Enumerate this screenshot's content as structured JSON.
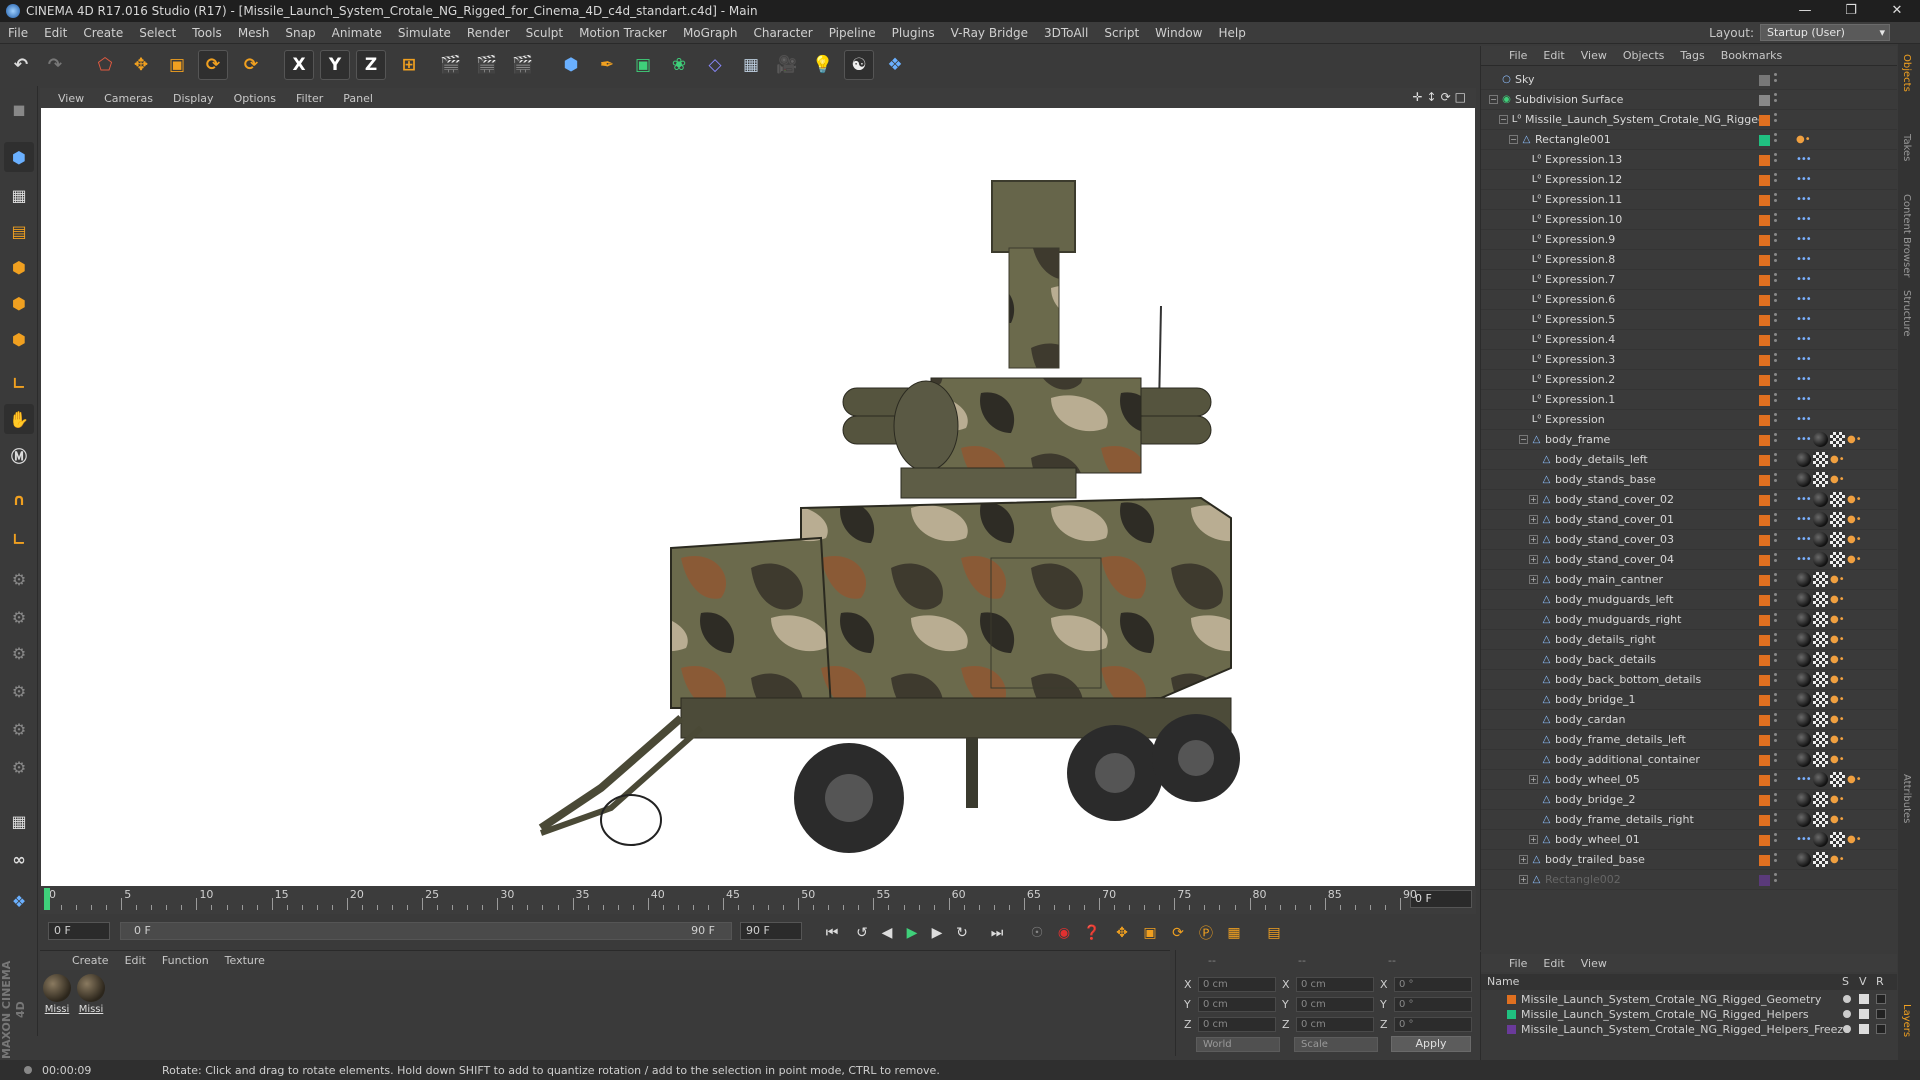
{
  "titlebar": {
    "title": "CINEMA 4D R17.016 Studio (R17) - [Missile_Launch_System_Crotale_NG_Rigged_for_Cinema_4D_c4d_standart.c4d] - Main",
    "minimize": "—",
    "maximize": "❐",
    "close": "✕"
  },
  "menubar": [
    "File",
    "Edit",
    "Create",
    "Select",
    "Tools",
    "Mesh",
    "Snap",
    "Animate",
    "Simulate",
    "Render",
    "Sculpt",
    "Motion Tracker",
    "MoGraph",
    "Character",
    "Pipeline",
    "Plugins",
    "V-Ray Bridge",
    "3DToAll",
    "Script",
    "Window",
    "Help"
  ],
  "layout": {
    "label": "Layout:",
    "value": "Startup (User)"
  },
  "toolbar_axes": {
    "x": "X",
    "y": "Y",
    "z": "Z"
  },
  "viewport_menu": [
    "View",
    "Cameras",
    "Display",
    "Options",
    "Filter",
    "Panel"
  ],
  "viewport_icons": [
    "✛",
    "↕",
    "⟳",
    "□"
  ],
  "timeline": {
    "ticks": [
      "0",
      "5",
      "10",
      "15",
      "20",
      "25",
      "30",
      "35",
      "40",
      "45",
      "50",
      "55",
      "60",
      "65",
      "70",
      "75",
      "80",
      "85",
      "90"
    ],
    "current_frame": "0 F"
  },
  "playbar": {
    "start": "0 F",
    "slider_start": "0 F",
    "slider_end": "90 F",
    "end": "90 F"
  },
  "material_menu": [
    "Create",
    "Edit",
    "Function",
    "Texture"
  ],
  "materials": [
    {
      "label": "Missi"
    },
    {
      "label": "Missi"
    }
  ],
  "coords": {
    "header_left": "--",
    "header_mid": "--",
    "header_right": "--",
    "rows": [
      {
        "a": "X",
        "av": "0 cm",
        "b": "X",
        "bv": "0 cm",
        "c": "X",
        "cv": "0 °"
      },
      {
        "a": "Y",
        "av": "0 cm",
        "b": "Y",
        "bv": "0 cm",
        "c": "Y",
        "cv": "0 °"
      },
      {
        "a": "Z",
        "av": "0 cm",
        "b": "Z",
        "bv": "0 cm",
        "c": "Z",
        "cv": "0 °"
      }
    ],
    "mode": "World",
    "scale": "Scale",
    "apply": "Apply"
  },
  "status": {
    "time": "00:00:09",
    "message": "Rotate: Click and drag to rotate elements. Hold down SHIFT to add to quantize rotation / add to the selection in point mode, CTRL to remove."
  },
  "object_menu": [
    "File",
    "Edit",
    "View",
    "Objects",
    "Tags",
    "Bookmarks"
  ],
  "objects": [
    {
      "name": "Sky",
      "level": 0,
      "expander": "",
      "icon": "sky",
      "layer": "#777777",
      "tags": []
    },
    {
      "name": "Subdivision Surface",
      "level": 0,
      "expander": "−",
      "icon": "subdiv",
      "layer": "#888888",
      "tags": []
    },
    {
      "name": "Missile_Launch_System_Crotale_NG_Rigged",
      "level": 1,
      "expander": "−",
      "icon": "null",
      "layer": "#e07020",
      "tags": []
    },
    {
      "name": "Rectangle001",
      "level": 2,
      "expander": "−",
      "icon": "poly",
      "layer": "#20c080",
      "tags": [
        "dot"
      ]
    },
    {
      "name": "Expression.13",
      "level": 3,
      "expander": "",
      "icon": "null",
      "layer": "#e07020",
      "tags": [
        "exp"
      ]
    },
    {
      "name": "Expression.12",
      "level": 3,
      "expander": "",
      "icon": "null",
      "layer": "#e07020",
      "tags": [
        "exp"
      ]
    },
    {
      "name": "Expression.11",
      "level": 3,
      "expander": "",
      "icon": "null",
      "layer": "#e07020",
      "tags": [
        "exp"
      ]
    },
    {
      "name": "Expression.10",
      "level": 3,
      "expander": "",
      "icon": "null",
      "layer": "#e07020",
      "tags": [
        "exp"
      ]
    },
    {
      "name": "Expression.9",
      "level": 3,
      "expander": "",
      "icon": "null",
      "layer": "#e07020",
      "tags": [
        "exp"
      ]
    },
    {
      "name": "Expression.8",
      "level": 3,
      "expander": "",
      "icon": "null",
      "layer": "#e07020",
      "tags": [
        "exp"
      ]
    },
    {
      "name": "Expression.7",
      "level": 3,
      "expander": "",
      "icon": "null",
      "layer": "#e07020",
      "tags": [
        "exp"
      ]
    },
    {
      "name": "Expression.6",
      "level": 3,
      "expander": "",
      "icon": "null",
      "layer": "#e07020",
      "tags": [
        "exp"
      ]
    },
    {
      "name": "Expression.5",
      "level": 3,
      "expander": "",
      "icon": "null",
      "layer": "#e07020",
      "tags": [
        "exp"
      ]
    },
    {
      "name": "Expression.4",
      "level": 3,
      "expander": "",
      "icon": "null",
      "layer": "#e07020",
      "tags": [
        "exp"
      ]
    },
    {
      "name": "Expression.3",
      "level": 3,
      "expander": "",
      "icon": "null",
      "layer": "#e07020",
      "tags": [
        "exp"
      ]
    },
    {
      "name": "Expression.2",
      "level": 3,
      "expander": "",
      "icon": "null",
      "layer": "#e07020",
      "tags": [
        "exp"
      ]
    },
    {
      "name": "Expression.1",
      "level": 3,
      "expander": "",
      "icon": "null",
      "layer": "#e07020",
      "tags": [
        "exp"
      ]
    },
    {
      "name": "Expression",
      "level": 3,
      "expander": "",
      "icon": "null",
      "layer": "#e07020",
      "tags": [
        "exp"
      ]
    },
    {
      "name": "body_frame",
      "level": 3,
      "expander": "−",
      "icon": "poly",
      "layer": "#e07020",
      "tags": [
        "exp",
        "mat",
        "chk",
        "dot"
      ]
    },
    {
      "name": "body_details_left",
      "level": 4,
      "expander": "",
      "icon": "poly",
      "layer": "#e07020",
      "tags": [
        "mat",
        "chk",
        "dot"
      ]
    },
    {
      "name": "body_stands_base",
      "level": 4,
      "expander": "",
      "icon": "poly",
      "layer": "#e07020",
      "tags": [
        "mat",
        "chk",
        "dot"
      ]
    },
    {
      "name": "body_stand_cover_02",
      "level": 4,
      "expander": "+",
      "icon": "poly",
      "layer": "#e07020",
      "tags": [
        "exp",
        "mat",
        "chk",
        "dot"
      ]
    },
    {
      "name": "body_stand_cover_01",
      "level": 4,
      "expander": "+",
      "icon": "poly",
      "layer": "#e07020",
      "tags": [
        "exp",
        "mat",
        "chk",
        "dot"
      ]
    },
    {
      "name": "body_stand_cover_03",
      "level": 4,
      "expander": "+",
      "icon": "poly",
      "layer": "#e07020",
      "tags": [
        "exp",
        "mat",
        "chk",
        "dot"
      ]
    },
    {
      "name": "body_stand_cover_04",
      "level": 4,
      "expander": "+",
      "icon": "poly",
      "layer": "#e07020",
      "tags": [
        "exp",
        "mat",
        "chk",
        "dot"
      ]
    },
    {
      "name": "body_main_cantner",
      "level": 4,
      "expander": "+",
      "icon": "poly",
      "layer": "#e07020",
      "tags": [
        "mat",
        "chk",
        "dot"
      ]
    },
    {
      "name": "body_mudguards_left",
      "level": 4,
      "expander": "",
      "icon": "poly",
      "layer": "#e07020",
      "tags": [
        "mat",
        "chk",
        "dot"
      ]
    },
    {
      "name": "body_mudguards_right",
      "level": 4,
      "expander": "",
      "icon": "poly",
      "layer": "#e07020",
      "tags": [
        "mat",
        "chk",
        "dot"
      ]
    },
    {
      "name": "body_details_right",
      "level": 4,
      "expander": "",
      "icon": "poly",
      "layer": "#e07020",
      "tags": [
        "mat",
        "chk",
        "dot"
      ]
    },
    {
      "name": "body_back_details",
      "level": 4,
      "expander": "",
      "icon": "poly",
      "layer": "#e07020",
      "tags": [
        "mat",
        "chk",
        "dot"
      ]
    },
    {
      "name": "body_back_bottom_details",
      "level": 4,
      "expander": "",
      "icon": "poly",
      "layer": "#e07020",
      "tags": [
        "mat",
        "chk",
        "dot"
      ]
    },
    {
      "name": "body_bridge_1",
      "level": 4,
      "expander": "",
      "icon": "poly",
      "layer": "#e07020",
      "tags": [
        "mat",
        "chk",
        "dot"
      ]
    },
    {
      "name": "body_cardan",
      "level": 4,
      "expander": "",
      "icon": "poly",
      "layer": "#e07020",
      "tags": [
        "mat",
        "chk",
        "dot"
      ]
    },
    {
      "name": "body_frame_details_left",
      "level": 4,
      "expander": "",
      "icon": "poly",
      "layer": "#e07020",
      "tags": [
        "mat",
        "chk",
        "dot"
      ]
    },
    {
      "name": "body_additional_container",
      "level": 4,
      "expander": "",
      "icon": "poly",
      "layer": "#e07020",
      "tags": [
        "mat",
        "chk",
        "dot"
      ]
    },
    {
      "name": "body_wheel_05",
      "level": 4,
      "expander": "+",
      "icon": "poly",
      "layer": "#e07020",
      "tags": [
        "exp",
        "mat",
        "chk",
        "dot"
      ]
    },
    {
      "name": "body_bridge_2",
      "level": 4,
      "expander": "",
      "icon": "poly",
      "layer": "#e07020",
      "tags": [
        "mat",
        "chk",
        "dot"
      ]
    },
    {
      "name": "body_frame_details_right",
      "level": 4,
      "expander": "",
      "icon": "poly",
      "layer": "#e07020",
      "tags": [
        "mat",
        "chk",
        "dot"
      ]
    },
    {
      "name": "body_wheel_01",
      "level": 4,
      "expander": "+",
      "icon": "poly",
      "layer": "#e07020",
      "tags": [
        "exp",
        "mat",
        "chk",
        "dot"
      ]
    },
    {
      "name": "body_trailed_base",
      "level": 3,
      "expander": "+",
      "icon": "poly",
      "layer": "#e07020",
      "tags": [
        "mat",
        "chk",
        "dot"
      ]
    },
    {
      "name": "Rectangle002",
      "level": 3,
      "expander": "+",
      "icon": "poly",
      "layer": "#5a3a7a",
      "tags": [],
      "dim": true
    }
  ],
  "side_tabs": [
    "Objects",
    "Takes",
    "Content Browser",
    "Structure",
    "Attributes",
    "Layers"
  ],
  "layers_menu": [
    "File",
    "Edit",
    "View"
  ],
  "layers_header": {
    "name": "Name",
    "s": "S",
    "v": "V",
    "r": "R"
  },
  "layers": [
    {
      "name": "Missile_Launch_System_Crotale_NG_Rigged_Geometry",
      "color": "#e07020"
    },
    {
      "name": "Missile_Launch_System_Crotale_NG_Rigged_Helpers",
      "color": "#20c080"
    },
    {
      "name": "Missile_Launch_System_Crotale_NG_Rigged_Helpers_Freeze",
      "color": "#6a3a9a"
    }
  ],
  "maxon_logo": "MAXON CINEMA 4D"
}
